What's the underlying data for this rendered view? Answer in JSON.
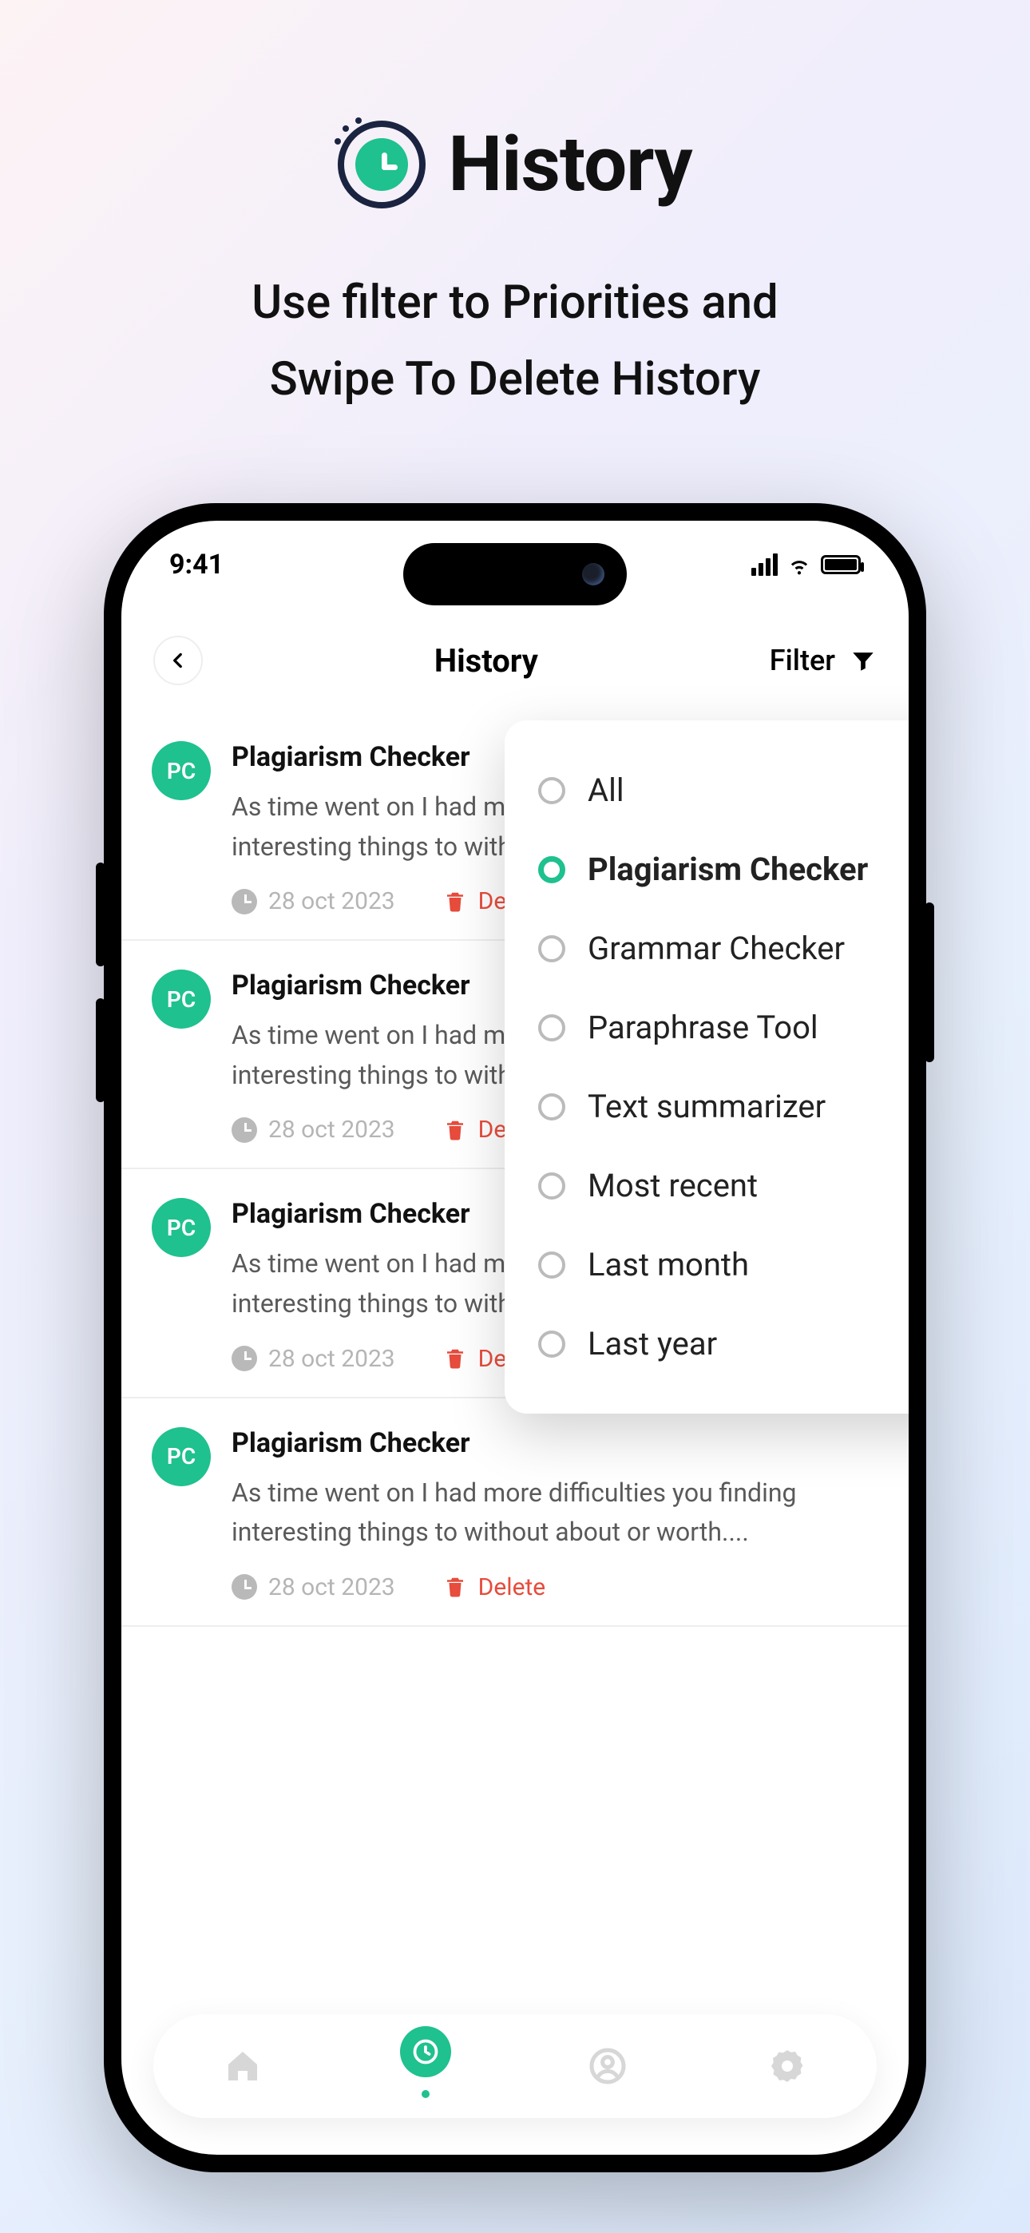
{
  "marketing": {
    "title": "History",
    "subtitle_1": "Use filter to Priorities and",
    "subtitle_2": "Swipe To Delete History"
  },
  "status": {
    "time": "9:41"
  },
  "appbar": {
    "title": "History",
    "filter_label": "Filter"
  },
  "filter_options": [
    {
      "label": "All",
      "selected": false
    },
    {
      "label": "Plagiarism Checker",
      "selected": true
    },
    {
      "label": "Grammar Checker",
      "selected": false
    },
    {
      "label": "Paraphrase Tool",
      "selected": false
    },
    {
      "label": "Text summarizer",
      "selected": false
    },
    {
      "label": "Most recent",
      "selected": false
    },
    {
      "label": "Last month",
      "selected": false
    },
    {
      "label": "Last year",
      "selected": false
    }
  ],
  "history": [
    {
      "avatar": "PC",
      "title": "Plagiarism Checker",
      "text": "As time went on I had more difficulties you finding interesting things to without about or worth....",
      "date": "28 oct 2023",
      "delete_label": "Delete"
    },
    {
      "avatar": "PC",
      "title": "Plagiarism Checker",
      "text": "As time went on I had more difficulties you finding interesting things to without about or worth....",
      "date": "28 oct 2023",
      "delete_label": "Delete"
    },
    {
      "avatar": "PC",
      "title": "Plagiarism Checker",
      "text": "As time went on I had more difficulties you finding interesting things to without about or worth....",
      "date": "28 oct 2023",
      "delete_label": "Delete"
    },
    {
      "avatar": "PC",
      "title": "Plagiarism Checker",
      "text": "As time went on I had more difficulties you finding interesting things to without about or worth....",
      "date": "28 oct 2023",
      "delete_label": "Delete"
    }
  ],
  "colors": {
    "accent": "#1fc18e",
    "danger": "#e74c3c"
  }
}
